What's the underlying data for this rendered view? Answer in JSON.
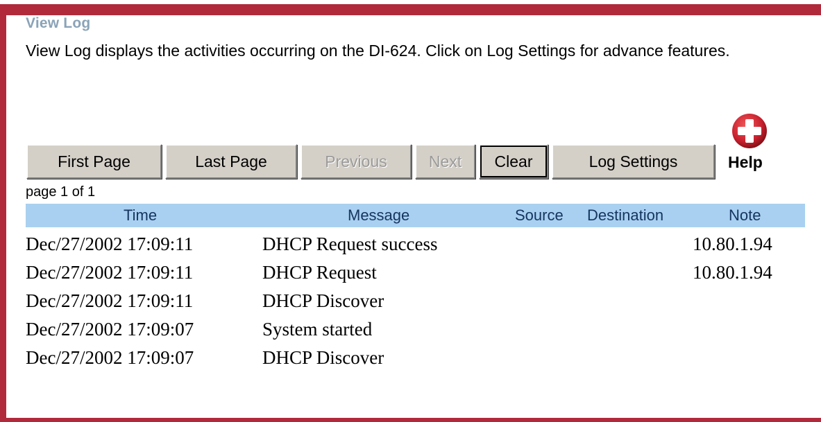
{
  "page": {
    "title": "View Log",
    "description": "View Log displays the activities occurring on the DI-624. Click on Log Settings for advance features."
  },
  "buttons": {
    "first_page": "First Page",
    "last_page": "Last Page",
    "previous": "Previous",
    "next": "Next",
    "clear": "Clear",
    "log_settings": "Log Settings",
    "help": "Help"
  },
  "pagination": {
    "label": "page 1 of 1"
  },
  "table": {
    "columns": [
      "Time",
      "Message",
      "Source",
      "Destination",
      "Note"
    ],
    "rows": [
      {
        "time": "Dec/27/2002 17:09:11",
        "message": "DHCP Request success",
        "source": "",
        "destination": "",
        "note": "10.80.1.94"
      },
      {
        "time": "Dec/27/2002 17:09:11",
        "message": "DHCP Request",
        "source": "",
        "destination": "",
        "note": "10.80.1.94"
      },
      {
        "time": "Dec/27/2002 17:09:11",
        "message": "DHCP Discover",
        "source": "",
        "destination": "",
        "note": ""
      },
      {
        "time": "Dec/27/2002 17:09:07",
        "message": "System started",
        "source": "",
        "destination": "",
        "note": ""
      },
      {
        "time": "Dec/27/2002 17:09:07",
        "message": "DHCP Discover",
        "source": "",
        "destination": "",
        "note": ""
      }
    ]
  },
  "colors": {
    "frame": "#b12a3c",
    "title": "#8aa3b8",
    "header_bar": "#a9d0f0",
    "button_face": "#d4d0c8",
    "help_icon": "#c8202e"
  },
  "icons": {
    "help": "plus-circle-icon"
  }
}
